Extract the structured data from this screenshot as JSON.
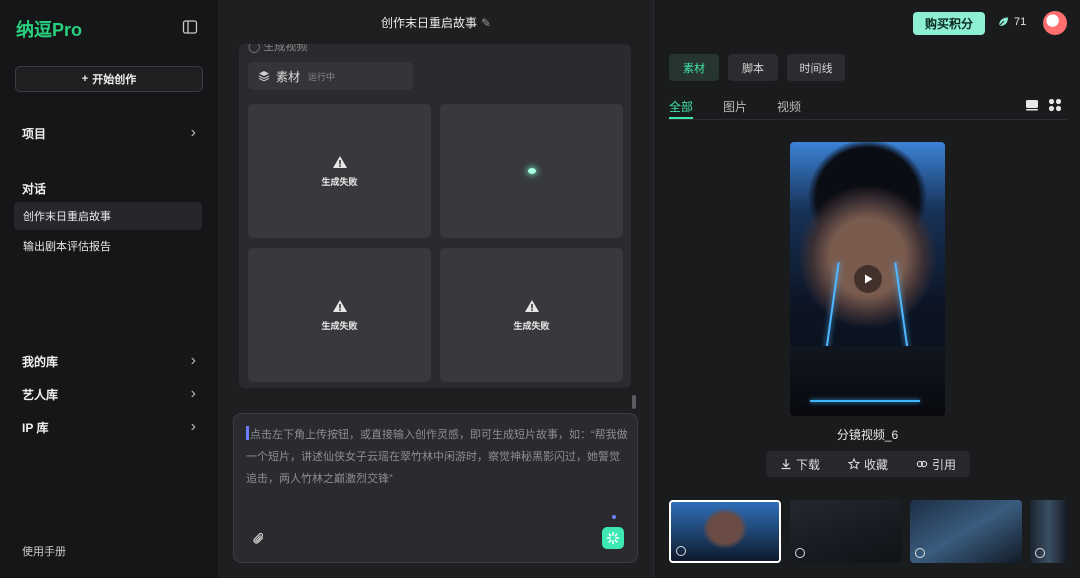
{
  "sidebar": {
    "logo": "纳逗Pro",
    "new_button": "开始创作",
    "new_button_icon": "+",
    "project_label": "项目",
    "conversations_label": "对话",
    "conversations": [
      "创作末日重启故事",
      "输出剧本评估报告"
    ],
    "library_label": "我的库",
    "artist_label": "艺人库",
    "ip_label": "IP 库",
    "manual_label": "使用手册"
  },
  "middle": {
    "title": "创作末日重启故事",
    "partial_text": "生成视频",
    "tag_label": "素材",
    "tag_status": "运行中",
    "cells": [
      {
        "state": "failed",
        "label": "生成失败"
      },
      {
        "state": "loading",
        "label": ""
      },
      {
        "state": "failed",
        "label": "生成失败"
      },
      {
        "state": "failed",
        "label": "生成失败"
      }
    ],
    "input_placeholder": "点击左下角上传按钮，或直接输入创作灵感，即可生成短片故事，如：“帮我做一个短片，讲述仙侠女子云瑶在翠竹林中闲游时，察觉神秘黑影闪过，她警觉追击，两人竹林之巅激烈交锋”"
  },
  "right": {
    "buy_button": "购买积分",
    "credits": "71",
    "segments": [
      "素材",
      "脚本",
      "时间线"
    ],
    "active_segment": "素材",
    "filter_tabs": [
      "全部",
      "图片",
      "视频"
    ],
    "active_filter": "全部",
    "preview_caption": "分镜视频_6",
    "actions": {
      "download": "下载",
      "favorite": "收藏",
      "cite": "引用"
    },
    "thumbnail_count": 4
  },
  "colors": {
    "accent": "#3fe6a8",
    "logo": "#29d17f",
    "buy_button_bg": "#8ef0d2",
    "panel_bg": "#2a2b2e"
  }
}
